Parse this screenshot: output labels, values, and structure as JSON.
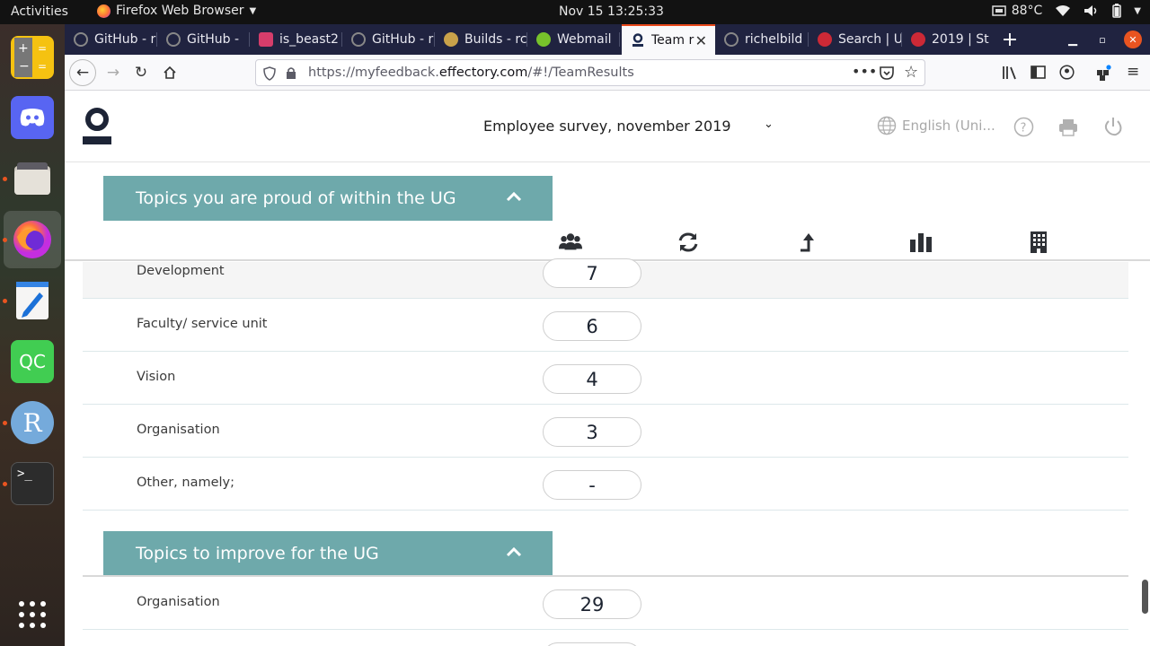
{
  "topbar": {
    "activities": "Activities",
    "app_menu": "Firefox Web Browser",
    "clock": "Nov 15  13:25:33",
    "temperature": "88°C"
  },
  "browser": {
    "tabs": [
      {
        "label": "GitHub - r",
        "icon": "github-icon",
        "color": "#ffffff"
      },
      {
        "label": "GitHub - ",
        "icon": "github-icon",
        "color": "#ffffff"
      },
      {
        "label": "is_beast2",
        "icon": "travis-icon",
        "color": "#d63d6b"
      },
      {
        "label": "GitHub - r",
        "icon": "github-icon",
        "color": "#ffffff"
      },
      {
        "label": "Builds - rc",
        "icon": "appveyor-icon",
        "color": "#c9a24a"
      },
      {
        "label": "Webmail",
        "icon": "webmail-icon",
        "color": "#77c22b"
      },
      {
        "label": "Team r",
        "icon": "effectory-icon",
        "color": "#1d2b4f"
      },
      {
        "label": "richelbild",
        "icon": "github-icon",
        "color": "#ffffff"
      },
      {
        "label": "Search | U",
        "icon": "uu-icon",
        "color": "#cc2936"
      },
      {
        "label": "2019 | St",
        "icon": "uu-icon",
        "color": "#cc2936"
      }
    ],
    "url_prefix": "https://myfeedback.",
    "url_domain": "effectory.com",
    "url_path": "/#!/TeamResults"
  },
  "app": {
    "survey_title": "Employee survey, november 2019",
    "language": "English (Uni..."
  },
  "sections": {
    "proud": {
      "title": "Topics you are proud of within the UG",
      "rows": [
        {
          "label": "Development",
          "value": "7"
        },
        {
          "label": "Faculty/ service unit",
          "value": "6"
        },
        {
          "label": "Vision",
          "value": "4"
        },
        {
          "label": "Organisation",
          "value": "3"
        },
        {
          "label": "Other, namely;",
          "value": "-"
        }
      ]
    },
    "improve": {
      "title": "Topics to improve for the UG",
      "rows": [
        {
          "label": "Organisation",
          "value": "29"
        }
      ]
    }
  },
  "colors": {
    "section_header": "#6ea9ab",
    "tab_accent": "#e8481b",
    "tabstrip": "#202340"
  }
}
